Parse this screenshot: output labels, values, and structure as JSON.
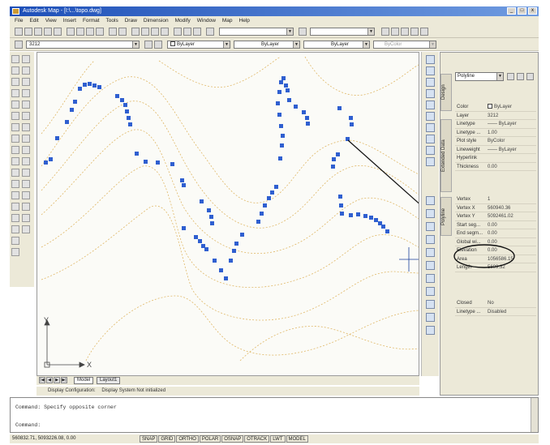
{
  "window": {
    "title": "Autodesk Map - [I:\\...\\topo.dwg]",
    "controls": [
      "_",
      "□",
      "x"
    ]
  },
  "menu": [
    "File",
    "Edit",
    "View",
    "Insert",
    "Format",
    "Tools",
    "Draw",
    "Dimension",
    "Modify",
    "Window",
    "Map",
    "Help"
  ],
  "layer_toolbar": {
    "layer_value": "3212",
    "color_value": "ByLayer",
    "linetype_value": "ByLayer",
    "lineweight_value": "ByLayer",
    "plotstyle_value": "ByColor"
  },
  "drawing": {
    "ucs_y_label": "Y",
    "ucs_x_label": "X",
    "tabs": [
      "Model",
      "Layout1"
    ],
    "active_tab": "Model",
    "display_config": "Display Configuration:",
    "display_system": "Display System Not initialized"
  },
  "side_tabs": [
    "Design",
    "Extended Data",
    "Polyline"
  ],
  "properties": {
    "object_type": "Polyline",
    "general": [
      {
        "key": "Color",
        "value": "ByLayer"
      },
      {
        "key": "Layer",
        "value": "3212"
      },
      {
        "key": "Linetype",
        "value": "—— ByLayer"
      },
      {
        "key": "Linetype ...",
        "value": "1.00"
      },
      {
        "key": "Plot style",
        "value": "ByColor"
      },
      {
        "key": "Lineweight",
        "value": "—— ByLayer"
      },
      {
        "key": "Hyperlink",
        "value": ""
      },
      {
        "key": "Thickness",
        "value": "0.00"
      }
    ],
    "geometry": [
      {
        "key": "Vertex",
        "value": "1"
      },
      {
        "key": "Vertex X",
        "value": "560940.36"
      },
      {
        "key": "Vertex Y",
        "value": "5092461.02"
      },
      {
        "key": "Start seg...",
        "value": "0.00"
      },
      {
        "key": "End segm...",
        "value": "0.00"
      },
      {
        "key": "Global wi...",
        "value": "0.00"
      },
      {
        "key": "Elevation",
        "value": "0.00"
      },
      {
        "key": "Area",
        "value": "1056586.15"
      },
      {
        "key": "Length",
        "value": "5699.32"
      }
    ],
    "misc": [
      {
        "key": "Closed",
        "value": "No"
      },
      {
        "key": "Linetype ...",
        "value": "Disabled"
      }
    ]
  },
  "command": {
    "line1": "Command:  Specify opposite corner",
    "line2": "Command:"
  },
  "status": {
    "coords": "560832.71, 5093226.08, 0.00",
    "modes": [
      "SNAP",
      "GRID",
      "ORTHO",
      "POLAR",
      "OSNAP",
      "OTRACK",
      "LWT",
      "MODEL"
    ]
  },
  "colors": {
    "grip": "#2f5fd0",
    "contour": "#e0b868",
    "highlight_ellipse": "#111111"
  }
}
